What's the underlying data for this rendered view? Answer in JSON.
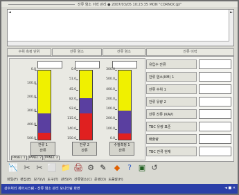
{
  "window": {
    "title": "잔류 염소 이력 관리 ● 2007/03/05 10:23:35 MON \"CORNOC@I\""
  },
  "log": {
    "left_arrow": "◄",
    "right_arrow": "►"
  },
  "headers": {
    "col1": "수위 측정 단위",
    "col2": "잔류 염소",
    "col3": "잔류 염소",
    "col4": "잔류 이력"
  },
  "gauges": [
    {
      "label_line1": "잔류 1",
      "label_line2": "잔류",
      "scale": [
        "0.0",
        "100.0",
        "200.0",
        "300.0",
        "400.0",
        "500.0"
      ],
      "segments": [
        {
          "color": "#f0f000",
          "level": 0.62
        },
        {
          "color": "#5a3fa0",
          "level": 0.28
        },
        {
          "color": "#e02020",
          "level": 0.1
        }
      ]
    },
    {
      "label_line1": "잔류 2",
      "label_line2": "잔류",
      "scale": [
        "0.0",
        "51.0",
        "45.0",
        "82.0",
        "93.0",
        "115.0",
        "140.0",
        "150.0"
      ],
      "segments": [
        {
          "color": "#f0f000",
          "level": 0.4
        },
        {
          "color": "#5a3fa0",
          "level": 0.22
        },
        {
          "color": "#e02020",
          "level": 0.38
        }
      ]
    },
    {
      "label_line1": "수질측정 1",
      "label_line2": "잔류",
      "scale": [
        "300.0",
        "500.0",
        "400.0",
        "200.0",
        "100.0",
        "200.0",
        "100.0",
        "0.0"
      ],
      "segments": [
        {
          "color": "#f0f000",
          "level": 0.58
        },
        {
          "color": "#5a3fa0",
          "level": 0.33
        },
        {
          "color": "#e02020",
          "level": 0.09
        }
      ]
    }
  ],
  "tabs": [
    "PANEL 1",
    "PANEL 2",
    "PANEL 3"
  ],
  "right_rows": [
    {
      "label": "유입수 잔류"
    },
    {
      "label": "잔류 염소(KM) 1"
    },
    {
      "label": "잔류 수위 1"
    },
    {
      "label": "잔류 유량 2"
    },
    {
      "label": "잔류 잔류 (KAV)"
    },
    {
      "label": "TBC 유량 표준"
    },
    {
      "label": "배출량"
    },
    {
      "label": "TBC 잔류 현재"
    }
  ],
  "toolbar": {
    "icons": [
      "chart-icon",
      "tool-icon",
      "tool2-icon",
      "page-icon",
      "folder-icon",
      "print-icon",
      "settings-icon",
      "pen-icon",
      "warning-icon",
      "help-icon",
      "monitor-icon",
      "refresh-icon"
    ]
  },
  "menu": {
    "items": [
      "파일(F)",
      "편집(E)",
      "보기(V)",
      "도구(T)",
      "관리(P)",
      "잔류염소(C)",
      "운영(O)",
      "도움말(H)"
    ]
  },
  "taskbar": {
    "title": "상수처리 제어시스템 - 잔류 염소 관리 모니터링 화면",
    "right": "◄ ■ ✕"
  }
}
